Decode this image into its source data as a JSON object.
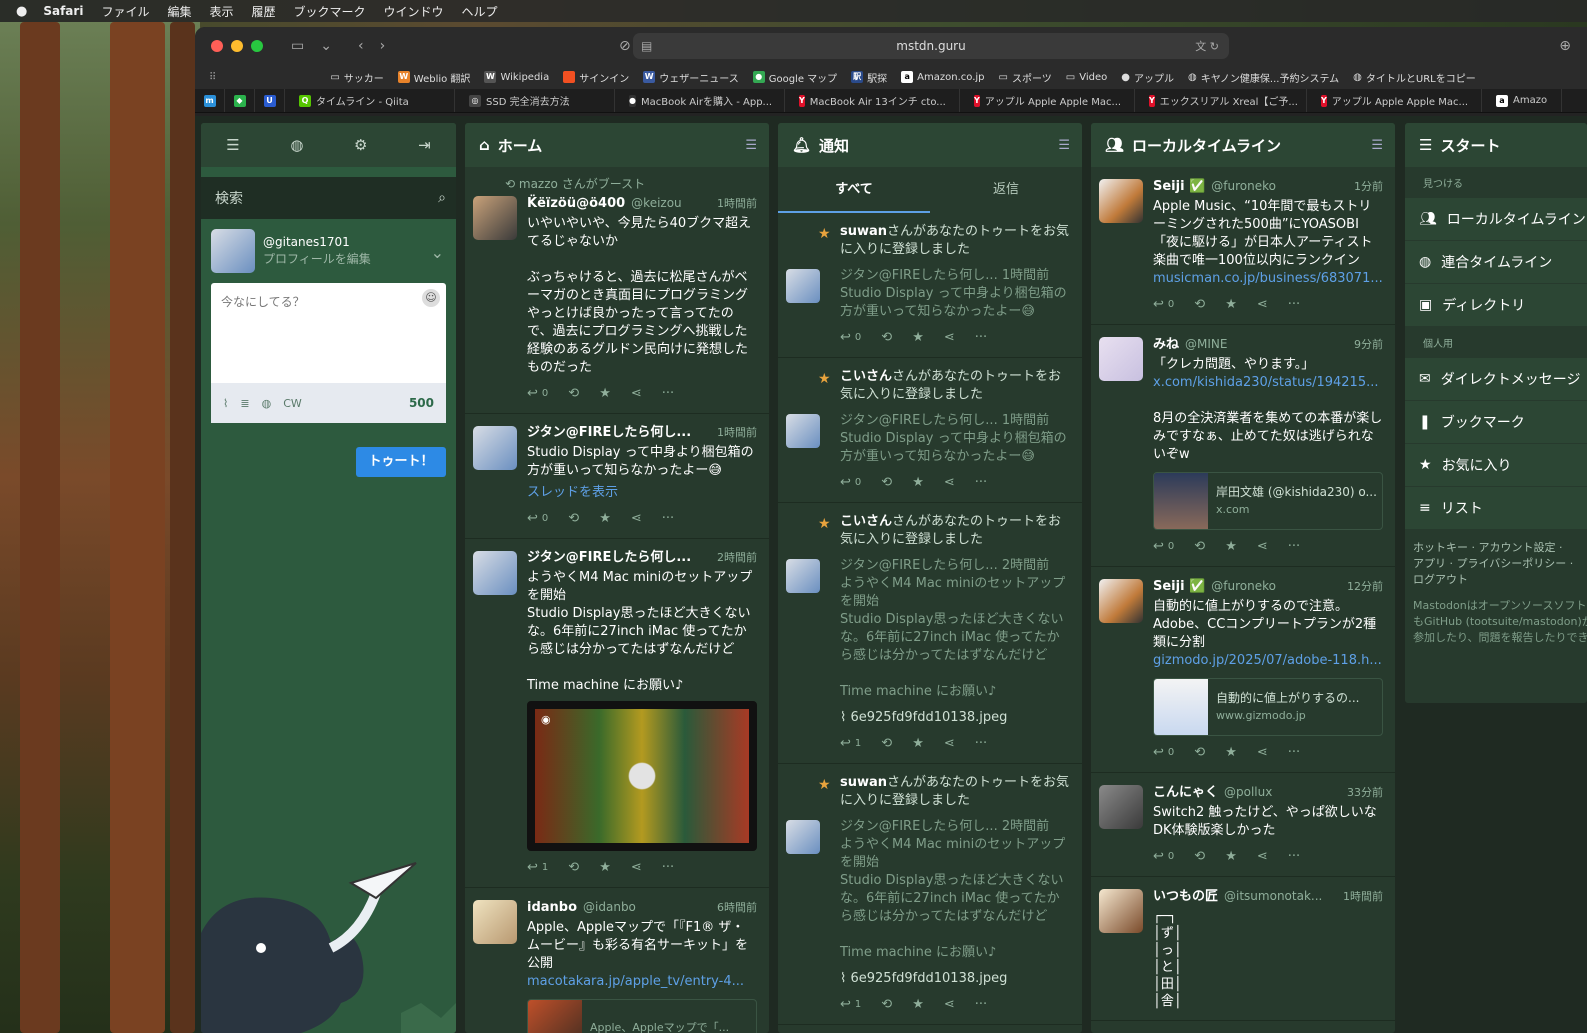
{
  "menubar": {
    "app": "Safari",
    "items": [
      "ファイル",
      "編集",
      "表示",
      "履歴",
      "ブックマーク",
      "ウインドウ",
      "ヘルプ"
    ]
  },
  "browser": {
    "url": "mstdn.guru",
    "bookmarks": [
      "サッカー",
      "Weblio 翻訳",
      "Wikipedia",
      "サインイン",
      "ウェザーニュース",
      "Google マップ",
      "駅探",
      "Amazon.co.jp",
      "スポーツ",
      "Video",
      "アップル",
      "キヤノン健康保...予約システム",
      "タイトルとURLをコピー"
    ],
    "tabs": [
      "タイムライン - Qiita",
      "SSD 完全消去方法",
      "MacBook Airを購入 - App...",
      "MacBook Air 13インチ cto...",
      "アップル Apple Apple Mac...",
      "エックスリアル Xreal【ご予...",
      "アップル Apple Apple Mac...",
      "Amazo"
    ]
  },
  "compose": {
    "search_placeholder": "検索",
    "handle": "@gitanes1701",
    "edit_profile": "プロフィールを編集",
    "placeholder": "今なにしてる？",
    "cw": "CW",
    "count": "500",
    "toot": "トゥート！"
  },
  "home": {
    "title": "ホーム",
    "boost": {
      "by": "mazzo",
      "text": "さんがブースト"
    },
    "posts": [
      {
        "name": "K̈ëïzöü@ö400",
        "acct": "@keizou",
        "time": "1時間前",
        "body": "いやいやいや、今見たら40ブクマ超えてるじゃないか\n\nぶっちゃけると、過去に松尾さんがベーマガのとき真面目にプログラミングやっとけば良かったって言ってたので、過去にプログラミングへ挑戦した経験のあるグルドン民向けに発想したものだった",
        "reply": "0"
      },
      {
        "name": "ジタン@FIREしたら何し...",
        "acct": "",
        "time": "1時間前",
        "body": "Studio Display って中身より梱包箱の方が重いって知らなかったよー😅",
        "link": "スレッドを表示",
        "reply": "0"
      },
      {
        "name": "ジタン@FIREしたら何し...",
        "acct": "",
        "time": "2時間前",
        "body": "ようやくM4 Mac miniのセットアップを開始\nStudio Display思ったほど大きくないな。6年前に27inch iMac 使ってたから感じは分かってたはずなんだけど\n\nTime machine にお願い♪",
        "reply": "1"
      },
      {
        "name": "idanbo",
        "acct": "@idanbo",
        "time": "6時間前",
        "body": "Apple、Appleマップで「『F1® ザ・ムービー』も彩る有名サーキット」を公開",
        "link": "macotakara.jp/apple_tv/entry-4...",
        "card": "Apple、Appleマップで「..."
      }
    ]
  },
  "notifications": {
    "title": "通知",
    "tab_all": "すべて",
    "tab_reply": "返信",
    "items": [
      {
        "who": "suwan",
        "msg": "さんがあなたのトゥートをお気に入りに登録しました",
        "name": "ジタン@FIREしたら何し...",
        "time": "1時間前",
        "body": "Studio Display って中身より梱包箱の方が重いって知らなかったよー😅",
        "reply": "0"
      },
      {
        "who": "こいさん",
        "msg": "さんがあなたのトゥートをお気に入りに登録しました",
        "name": "ジタン@FIREしたら何し...",
        "time": "1時間前",
        "body": "Studio Display って中身より梱包箱の方が重いって知らなかったよー😅",
        "reply": "0"
      },
      {
        "who": "こいさん",
        "msg": "さんがあなたのトゥートをお気に入りに登録しました",
        "name": "ジタン@FIREしたら何し...",
        "time": "2時間前",
        "body": "ようやくM4 Mac miniのセットアップを開始\nStudio Display思ったほど大きくないな。6年前に27inch iMac 使ってたから感じは分かってたはずなんだけど\n\nTime machine にお願い♪",
        "file": "6e925fd9fdd10138.jpeg",
        "reply": "1"
      },
      {
        "who": "suwan",
        "msg": "さんがあなたのトゥートをお気に入りに登録しました",
        "name": "ジタン@FIREしたら何し...",
        "time": "2時間前",
        "body": "ようやくM4 Mac miniのセットアップを開始\nStudio Display思ったほど大きくないな。6年前に27inch iMac 使ってたから感じは分かってたはずなんだけど\n\nTime machine にお願い♪",
        "file": "6e925fd9fdd10138.jpeg",
        "reply": "1"
      }
    ]
  },
  "local": {
    "title": "ローカルタイムライン",
    "posts": [
      {
        "name": "Seiji ✅",
        "acct": "@furoneko",
        "time": "1分前",
        "body": "Apple Music、“10年間で最もストリーミングされた500曲”にYOASOBI「夜に駆ける」が日本人アーティスト楽曲で唯一100位以内にランクイン",
        "link": "musicman.co.jp/business/683071...",
        "reply": "0"
      },
      {
        "name": "みね",
        "acct": "@MINE",
        "time": "9分前",
        "body": "「クレカ問題、やります。」",
        "link": "x.com/kishida230/status/194215...",
        "body2": "8月の全決済業者を集めての本番が楽しみですなぁ、止めてた奴は逃げられないぞw",
        "card_title": "岸田文雄 (@kishida230) o...",
        "card_site": "x.com",
        "reply": "0"
      },
      {
        "name": "Seiji ✅",
        "acct": "@furoneko",
        "time": "12分前",
        "body": "自動的に値上がりするので注意。\nAdobe、CCコンプリートプランが2種類に分割",
        "link": "gizmodo.jp/2025/07/adobe-118.h...",
        "card_title": "自動的に値上がりするの...",
        "card_site": "www.gizmodo.jp",
        "reply": "0"
      },
      {
        "name": "こんにゃく",
        "acct": "@pollux",
        "time": "33分前",
        "body": "Switch2 触ったけど、やっぱ欲しいな\nDK体験版楽しかった",
        "reply": "0"
      },
      {
        "name": "いつもの匠",
        "acct": "@itsumonotak...",
        "time": "1時間前",
        "body": "┌─┐\n│ず│\n│っ│\n│と│\n│田│\n│舎│"
      }
    ]
  },
  "start": {
    "title": "スタート",
    "sec_find": "見つける",
    "local": "ローカルタイムライン",
    "federated": "連合タイムライン",
    "directory": "ディレクトリ",
    "sec_personal": "個人用",
    "dm": "ダイレクトメッセージ",
    "bookmarks": "ブックマーク",
    "favourites": "お気に入り",
    "lists": "リスト",
    "footer1": "ホットキー · アカウント設定 ·",
    "footer2": "アプリ · プライバシーポリシー ·",
    "footer3": "ログアウト",
    "footer4": "Mastodonはオープンソースソフトウェアです。",
    "footer5": "もGitHub (tootsuite/mastodon)から",
    "footer6": "参加したり、問題を報告したりできます。"
  },
  "colors": {
    "accent": "#2d8ae5",
    "column": "#273a2d",
    "header": "#2c4634",
    "star": "#e8a33d",
    "link": "#5ea0e6"
  }
}
